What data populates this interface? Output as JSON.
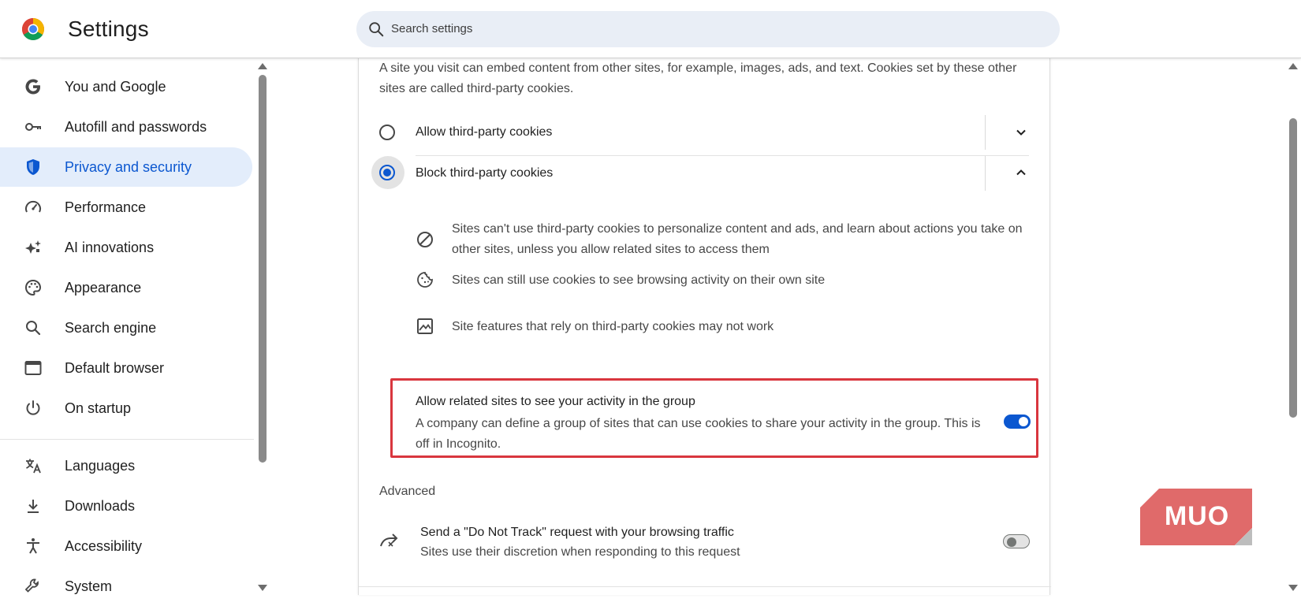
{
  "header": {
    "title": "Settings",
    "search_placeholder": "Search settings"
  },
  "sidebar": {
    "items": [
      {
        "label": "You and Google",
        "icon": "google-g-icon"
      },
      {
        "label": "Autofill and passwords",
        "icon": "key-icon"
      },
      {
        "label": "Privacy and security",
        "icon": "shield-icon",
        "active": true
      },
      {
        "label": "Performance",
        "icon": "speedometer-icon"
      },
      {
        "label": "AI innovations",
        "icon": "sparkle-icon"
      },
      {
        "label": "Appearance",
        "icon": "palette-icon"
      },
      {
        "label": "Search engine",
        "icon": "search-icon"
      },
      {
        "label": "Default browser",
        "icon": "browser-window-icon"
      },
      {
        "label": "On startup",
        "icon": "power-icon"
      },
      {
        "label": "Languages",
        "icon": "translate-icon"
      },
      {
        "label": "Downloads",
        "icon": "download-icon"
      },
      {
        "label": "Accessibility",
        "icon": "accessibility-icon"
      },
      {
        "label": "System",
        "icon": "wrench-icon"
      }
    ]
  },
  "content": {
    "intro": "A site you visit can embed content from other sites, for example, images, ads, and text. Cookies set by these other sites are called third-party cookies.",
    "options": [
      {
        "label": "Allow third-party cookies",
        "selected": false,
        "expanded": false
      },
      {
        "label": "Block third-party cookies",
        "selected": true,
        "expanded": true
      }
    ],
    "details": [
      {
        "icon": "block-icon",
        "text": "Sites can't use third-party cookies to personalize content and ads, and learn about actions you take on other sites, unless you allow related sites to access them"
      },
      {
        "icon": "cookie-icon",
        "text": "Sites can still use cookies to see browsing activity on their own site"
      },
      {
        "icon": "broken-image-icon",
        "text": "Site features that rely on third-party cookies may not work"
      }
    ],
    "related_sites": {
      "title": "Allow related sites to see your activity in the group",
      "description": "A company can define a group of sites that can use cookies to share your activity in the group. This is off in Incognito.",
      "enabled": true
    },
    "advanced": {
      "heading": "Advanced",
      "dnt_title": "Send a \"Do Not Track\" request with your browsing traffic",
      "dnt_description": "Sites use their discretion when responding to this request",
      "dnt_enabled": false
    }
  },
  "watermark": {
    "text": "MUO"
  },
  "colors": {
    "accent": "#0b57d0",
    "active_nav_bg": "#e3edfb",
    "highlight_border": "#d9363e",
    "watermark_bg": "#e06a6a"
  }
}
